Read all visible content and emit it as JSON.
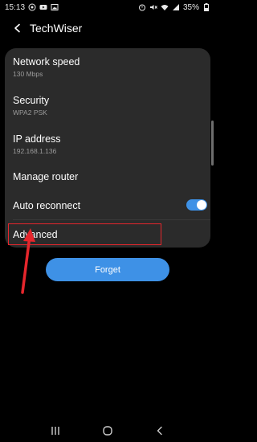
{
  "status_bar": {
    "time": "15:13",
    "battery": "35%"
  },
  "header": {
    "title": "TechWiser"
  },
  "settings": {
    "network_speed": {
      "title": "Network speed",
      "value": "130 Mbps"
    },
    "security": {
      "title": "Security",
      "value": "WPA2 PSK"
    },
    "ip_address": {
      "title": "IP address",
      "value": "192.168.1.136"
    },
    "manage_router": {
      "title": "Manage router"
    },
    "auto_reconnect": {
      "title": "Auto reconnect",
      "enabled": true
    },
    "advanced": {
      "title": "Advanced"
    }
  },
  "actions": {
    "forget_label": "Forget"
  },
  "colors": {
    "accent": "#3e91e6",
    "card_bg": "#2b2b2b",
    "annotation": "#e5262c"
  },
  "icons": {
    "status_left": [
      "whatsapp-icon",
      "youtube-icon",
      "image-icon"
    ],
    "status_right": [
      "alarm-icon",
      "mute-icon",
      "wifi-icon",
      "signal-icon",
      "battery-icon"
    ],
    "nav": [
      "recent-apps-icon",
      "home-icon",
      "back-icon"
    ]
  }
}
